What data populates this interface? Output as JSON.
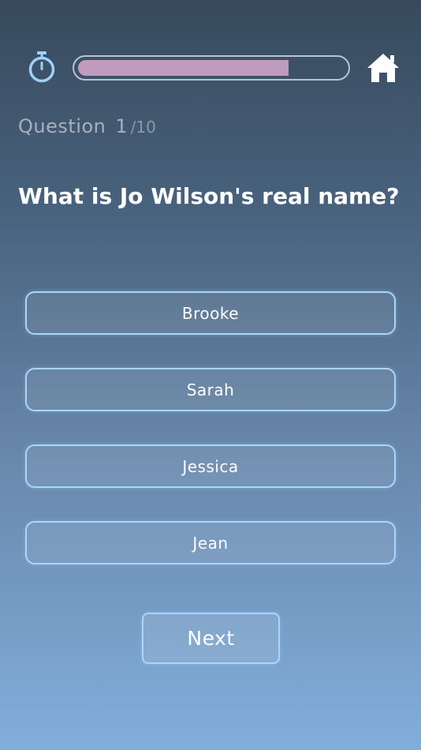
{
  "header": {
    "timer_icon": "stopwatch-icon",
    "home_icon": "home-icon",
    "progress": {
      "value": 0.79,
      "fill_color": "#bf9bbd",
      "track_color": "#b6c3d2"
    }
  },
  "question_counter": {
    "label": "Question",
    "current": "1",
    "separator": "/",
    "total": "10"
  },
  "question": {
    "text": "What is Jo Wilson's real name?"
  },
  "answers": [
    {
      "label": "Brooke"
    },
    {
      "label": "Sarah"
    },
    {
      "label": "Jessica"
    },
    {
      "label": "Jean"
    }
  ],
  "next_button": {
    "label": "Next"
  },
  "colors": {
    "accent_border": "#a9d6fb",
    "text_primary": "#ffffff",
    "text_muted": "#a7b1bd"
  }
}
